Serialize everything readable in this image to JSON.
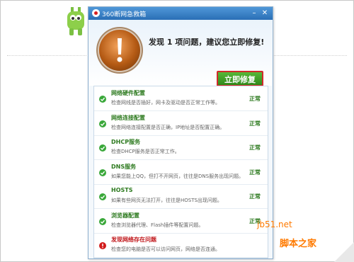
{
  "window": {
    "title": "360断网急救箱",
    "minimize_glyph": "–",
    "close_glyph": "✕"
  },
  "header": {
    "headline": "发现 1 项问题，建议您立即修复!",
    "fix_button_label": "立即修复",
    "warning_icon": "exclamation-warning-icon"
  },
  "checks": [
    {
      "title": "网络硬件配置",
      "desc": "检查网线是否插好，网卡及驱动是否正常工作等。",
      "status": "正常",
      "state": "ok"
    },
    {
      "title": "网络连接配置",
      "desc": "检查网络连接配置是否正确，IP地址是否配置正确。",
      "status": "正常",
      "state": "ok"
    },
    {
      "title": "DHCP服务",
      "desc": "检查DHCP服务是否正常工作。",
      "status": "正常",
      "state": "ok"
    },
    {
      "title": "DNS服务",
      "desc": "如果您能上QQ，但打不开网页，往往是DNS服务出现问题。",
      "status": "正常",
      "state": "ok"
    },
    {
      "title": "HOSTS",
      "desc": "如果有些网页无法打开，往往是HOSTS出现问题。",
      "status": "正常",
      "state": "ok"
    },
    {
      "title": "浏览器配置",
      "desc": "检查浏览器代理、Flash插件等配置问题。",
      "status": "正常",
      "state": "ok"
    },
    {
      "title": "发现网络存在问题",
      "desc": "检查您的电脑是否可以访问网页，网络是否连通。",
      "status": "",
      "state": "error"
    }
  ],
  "colors": {
    "ok": "#3aa83a",
    "error": "#d21b1b",
    "accent": "#2a6fb6"
  },
  "watermark": {
    "main": "脚本之家",
    "site": "jb51.net"
  }
}
